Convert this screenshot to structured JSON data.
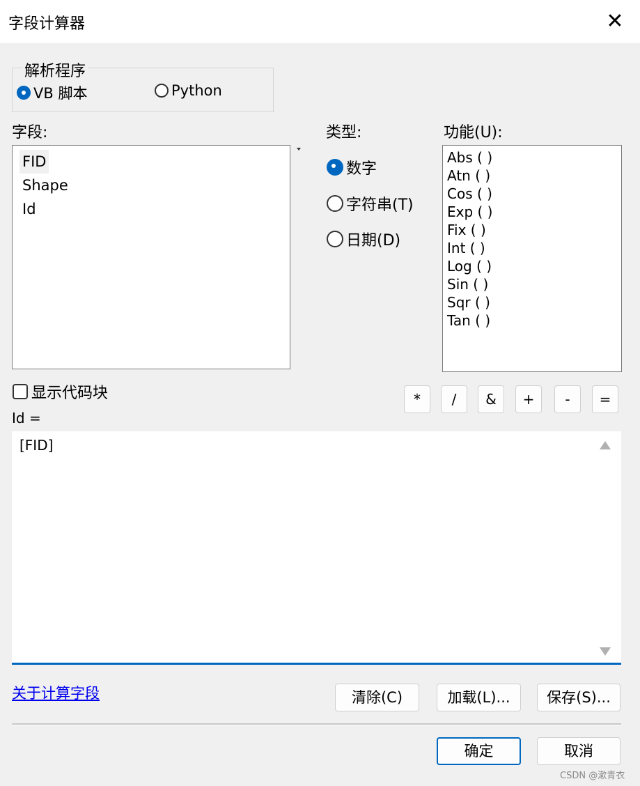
{
  "window": {
    "title": "字段计算器",
    "close_label": "✕"
  },
  "parser": {
    "legend": "解析程序",
    "options": [
      {
        "label": "VB 脚本",
        "checked": true
      },
      {
        "label": "Python",
        "checked": false
      }
    ]
  },
  "fields": {
    "label": "字段:",
    "items": [
      "FID",
      "Shape",
      "Id"
    ],
    "selected": "FID"
  },
  "type": {
    "label": "类型:",
    "options": [
      {
        "label": "数字",
        "checked": true
      },
      {
        "label": "字符串(T)",
        "checked": false
      },
      {
        "label": "日期(D)",
        "checked": false
      }
    ]
  },
  "functions": {
    "label": "功能(U):",
    "items": [
      "Abs ( )",
      "Atn ( )",
      "Cos ( )",
      "Exp ( )",
      "Fix ( )",
      "Int ( )",
      "Log ( )",
      "Sin ( )",
      "Sqr ( )",
      "Tan ( )"
    ]
  },
  "code_block": {
    "label": "显示代码块",
    "checked": false
  },
  "operators": [
    "*",
    "/",
    "&",
    "+",
    "-",
    "="
  ],
  "expression": {
    "label": "Id =",
    "value": "[FID]"
  },
  "about_link": "关于计算字段",
  "actions": {
    "clear": "清除(C)",
    "load": "加载(L)...",
    "save": "保存(S)..."
  },
  "dialog": {
    "ok": "确定",
    "cancel": "取消"
  },
  "watermark": "CSDN @漱青衣",
  "colors": {
    "accent": "#0067c0",
    "link": "#0000ee",
    "background": "#f0f0f0"
  }
}
